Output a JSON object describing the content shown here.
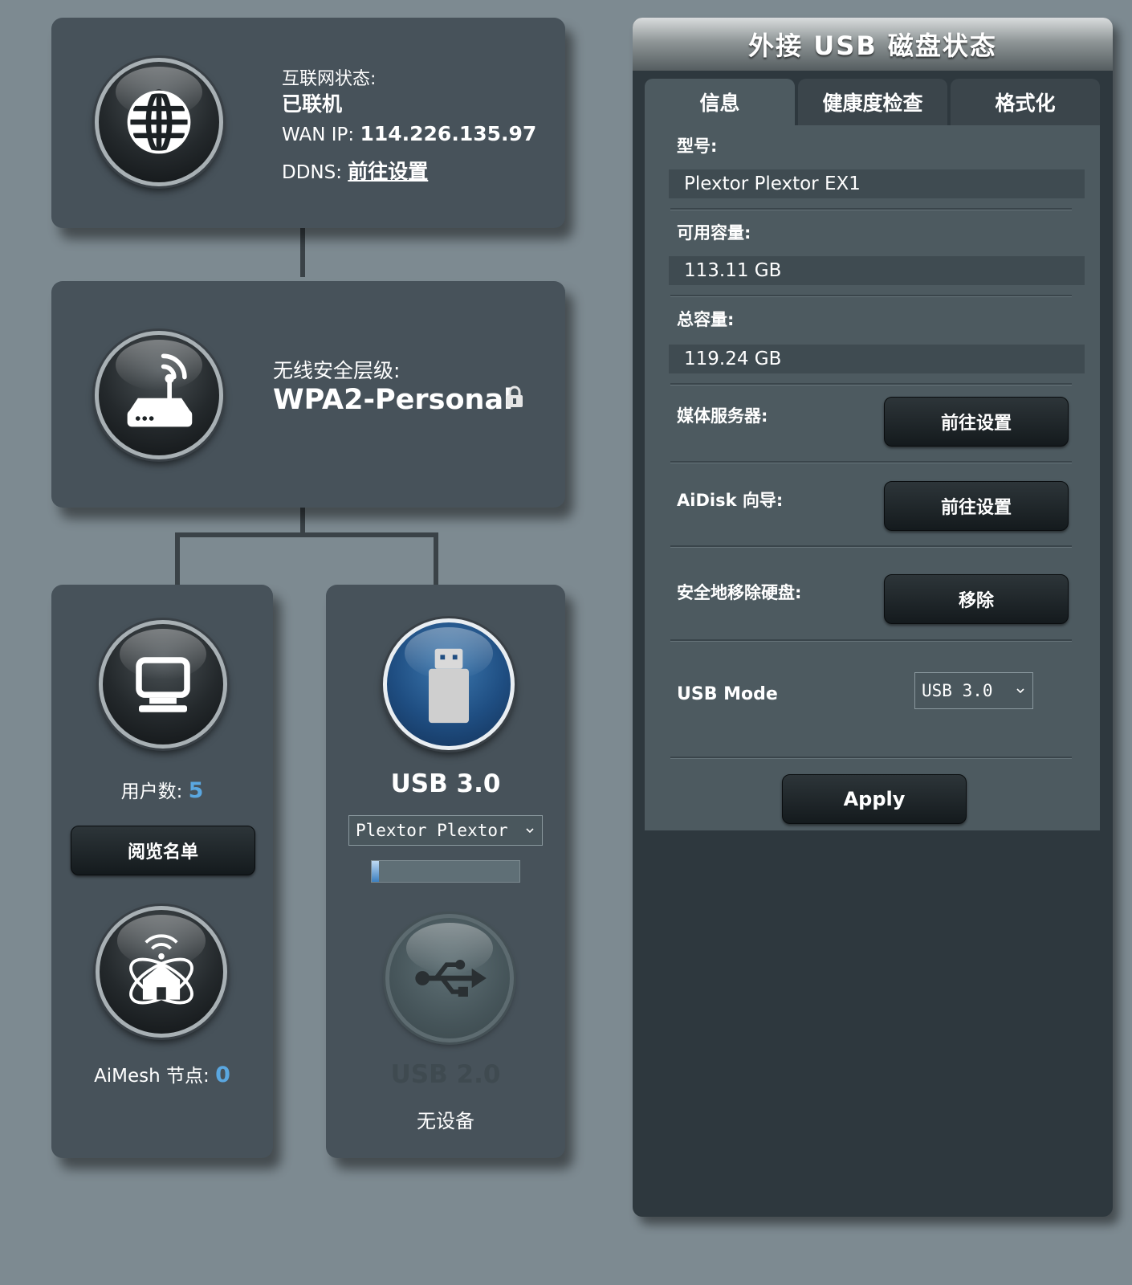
{
  "internet": {
    "status_label": "互联网状态:",
    "status_value": "已联机",
    "wan_label": "WAN IP:",
    "wan_value": "114.226.135.97",
    "ddns_label": "DDNS:",
    "ddns_link": "前往设置"
  },
  "wireless": {
    "security_label": "无线安全层级:",
    "security_value": "WPA2-Personal"
  },
  "clients": {
    "label": "用户数:",
    "count": "5",
    "view_list_button": "阅览名单"
  },
  "aimesh": {
    "label": "AiMesh 节点:",
    "count": "0"
  },
  "usb_ports": {
    "usb3_title": "USB 3.0",
    "usb3_device": "Plextor Plextor",
    "usb3_usage_fraction": 0.05,
    "usb2_title": "USB 2.0",
    "usb2_status": "无设备"
  },
  "panel": {
    "title": "外接 USB 磁盘状态",
    "tabs": [
      "信息",
      "健康度检查",
      "格式化"
    ],
    "model_label": "型号:",
    "model_value": "Plextor Plextor EX1",
    "free_label": "可用容量:",
    "free_value": "113.11 GB",
    "total_label": "总容量:",
    "total_value": "119.24 GB",
    "media_label": "媒体服务器:",
    "media_button": "前往设置",
    "aidisk_label": "AiDisk 向导:",
    "aidisk_button": "前往设置",
    "eject_label": "安全地移除硬盘:",
    "eject_button": "移除",
    "usb_mode_label": "USB Mode",
    "usb_mode_value": "USB 3.0",
    "apply_button": "Apply"
  },
  "colors": {
    "background": "#7d8a91",
    "card": "#47525a",
    "accent_count": "#5aa7e0"
  }
}
